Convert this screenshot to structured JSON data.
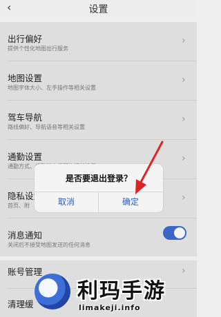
{
  "header": {
    "back_icon": "chevron-left-icon",
    "title": "设置"
  },
  "settings": [
    {
      "title": "出行偏好",
      "subtitle": "提供个性化地图出行服务"
    },
    {
      "title": "地图设置",
      "subtitle": "地图字体大小、左手操作等相关设置"
    },
    {
      "title": "驾车导航",
      "subtitle": "路线偏好、导航语音等相关设置"
    },
    {
      "title": "通勤设置",
      "subtitle": "通勤方式、通勤消息提醒等相关设置"
    },
    {
      "title": "隐私设置",
      "subtitle": "首页、附"
    },
    {
      "title": "消息通知",
      "subtitle": "关闭后不接受地图发送的任何消息",
      "toggle_on": true,
      "toggle_color": "#3a67c8"
    }
  ],
  "account": [
    {
      "title": "账号管理"
    },
    {
      "title": "清理缓"
    }
  ],
  "dialog": {
    "message": "是否要退出登录？",
    "cancel_label": "取消",
    "confirm_label": "确定",
    "button_color": "#2d5fbf"
  },
  "annotation": {
    "arrow_color": "#e02222"
  },
  "watermark": {
    "title": "利玛手游",
    "url": "limakeji.info"
  }
}
